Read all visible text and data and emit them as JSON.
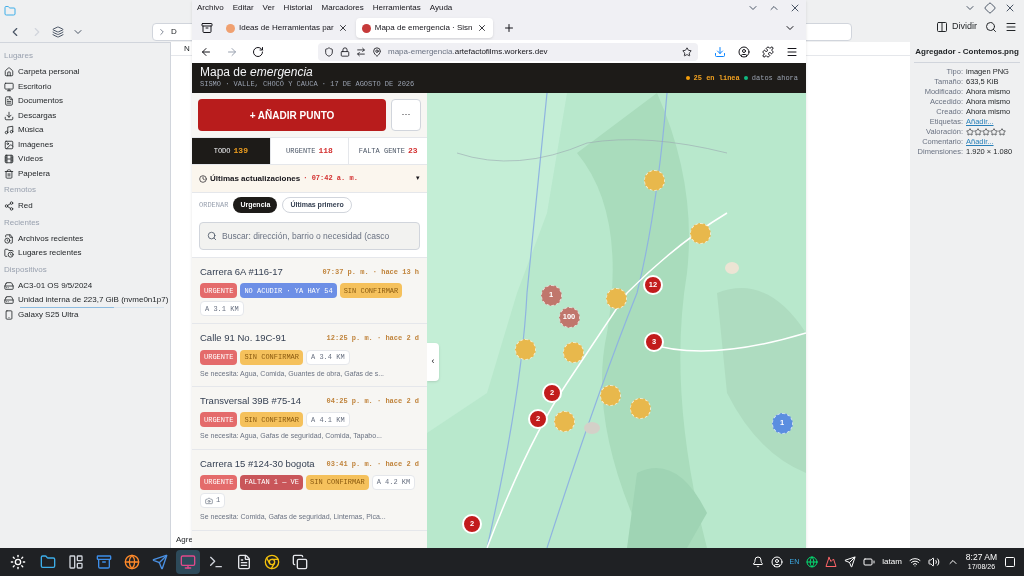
{
  "file_manager": {
    "breadcrumb": "D",
    "column_header": "N",
    "status_text": "Agre",
    "sidebar": [
      {
        "heading": "Lugares",
        "items": [
          {
            "label": "Carpeta personal",
            "kind": "home"
          },
          {
            "label": "Escritorio",
            "kind": "desktop"
          },
          {
            "label": "Documentos",
            "kind": "documents"
          },
          {
            "label": "Descargas",
            "kind": "downloads"
          },
          {
            "label": "Música",
            "kind": "music"
          },
          {
            "label": "Imágenes",
            "kind": "images"
          },
          {
            "label": "Vídeos",
            "kind": "videos"
          },
          {
            "label": "Papelera",
            "kind": "trash"
          }
        ]
      },
      {
        "heading": "Remotos",
        "items": [
          {
            "label": "Red",
            "kind": "network"
          }
        ]
      },
      {
        "heading": "Recientes",
        "items": [
          {
            "label": "Archivos recientes",
            "kind": "recent-files"
          },
          {
            "label": "Lugares recientes",
            "kind": "recent-places"
          }
        ]
      },
      {
        "heading": "Dispositivos",
        "items": [
          {
            "label": "AC3-01 OS 9/5/2024",
            "kind": "drive"
          },
          {
            "label": "Unidad interna de 223,7 GiB (nvme0n1p7)",
            "kind": "disk",
            "level": 0.65
          },
          {
            "label": "Galaxy S25 Ultra",
            "kind": "phone"
          }
        ]
      }
    ],
    "split_button": "Dividir",
    "info_panel": {
      "title": "Agregador - Contemos.png",
      "rows": [
        {
          "label": "Tipo:",
          "kind": "text",
          "value": "imagen PNG"
        },
        {
          "label": "Tamaño:",
          "kind": "text",
          "value": "633,5 KiB"
        },
        {
          "label": "Modificado:",
          "kind": "text",
          "value": "Ahora mismo"
        },
        {
          "label": "Accedido:",
          "kind": "text",
          "value": "Ahora mismo"
        },
        {
          "label": "Creado:",
          "kind": "text",
          "value": "Ahora mismo"
        },
        {
          "label": "Etiquetas:",
          "kind": "link",
          "value": "Añadir..."
        },
        {
          "label": "Valoración:",
          "kind": "stars",
          "stars": 0
        },
        {
          "label": "Comentario:",
          "kind": "link",
          "value": "Añadir..."
        },
        {
          "label": "Dimensiones:",
          "kind": "text",
          "value": "1.920 × 1.080"
        }
      ]
    }
  },
  "browser": {
    "menu": [
      "Archivo",
      "Editar",
      "Ver",
      "Historial",
      "Marcadores",
      "Herramientas",
      "Ayuda"
    ],
    "tabs": [
      {
        "title": "Ideas de Herramientas par",
        "selected": false
      },
      {
        "title": "Mapa de emergencia · Sisn",
        "selected": true
      }
    ],
    "url_host": "mapa-emergencia.",
    "url_domain": "artefactofilms.workers.dev"
  },
  "app": {
    "title": "Mapa de *emergencia*",
    "subtitle": "SISMO · VALLE, CHOCÓ Y CAUCA · 17 DE AGOSTO DE 2026",
    "status": [
      {
        "label": "25 en línea",
        "color": "#f59e0b"
      },
      {
        "label": "datos ahora",
        "color": "#10b981"
      }
    ],
    "add_button": "+ AÑADIR PUNTO",
    "more_button": "···",
    "filters": [
      {
        "label": "TODO",
        "count": "139",
        "selected": true
      },
      {
        "label": "URGENTE",
        "count": "118",
        "selected": false
      },
      {
        "label": "FALTA GENTE",
        "count": "23",
        "selected": false
      }
    ],
    "updates": {
      "label": "Últimas actualizaciones",
      "time": "· 07:42 a. m.",
      "caret": "▾"
    },
    "sort": {
      "label": "ORDENAR",
      "options": [
        {
          "label": "Urgencia",
          "selected": true
        },
        {
          "label": "Últimas primero",
          "selected": false
        }
      ]
    },
    "search": {
      "placeholder": "Buscar: dirección, barrio o necesidad (casco"
    },
    "reports": [
      {
        "title": "Carrera 6A #116-17",
        "time": "07:37 p. m. · hace 13 h",
        "tags": [
          {
            "kind": "urgent",
            "text": "URGENTE"
          },
          {
            "kind": "info",
            "text": "NO ACUDIR · YA HAY 54"
          },
          {
            "kind": "pending",
            "text": "SIN CONFIRMAR"
          },
          {
            "kind": "distance",
            "text": "A 3.1 KM"
          }
        ]
      },
      {
        "title": "Calle 91 No. 19C-91",
        "time": "12:25 p. m. · hace 2 d",
        "tags": [
          {
            "kind": "urgent",
            "text": "URGENTE"
          },
          {
            "kind": "pending",
            "text": "SIN CONFIRMAR"
          },
          {
            "kind": "distance",
            "text": "A 3.4 KM"
          }
        ],
        "needs": "Se necesita: Agua, Comida, Guantes de obra, Gafas de s..."
      },
      {
        "title": "Transversal 39B #75-14",
        "time": "04:25 p. m. · hace 2 d",
        "tags": [
          {
            "kind": "urgent",
            "text": "URGENTE"
          },
          {
            "kind": "pending",
            "text": "SIN CONFIRMAR"
          },
          {
            "kind": "distance",
            "text": "A 4.1 KM"
          }
        ],
        "needs": "Se necesita: Agua, Gafas de seguridad, Comida, Tapabo..."
      },
      {
        "title": "Carrera 15 #124-30 bogota",
        "time": "03:41 p. m. · hace 2 d",
        "tags": [
          {
            "kind": "urgent",
            "text": "URGENTE"
          },
          {
            "kind": "missing",
            "text": "FALTAN 1 — VE"
          },
          {
            "kind": "pending",
            "text": "SIN CONFIRMAR"
          },
          {
            "kind": "distance",
            "text": "A 4.2 KM"
          },
          {
            "kind": "photos",
            "text": "1"
          }
        ],
        "needs": "Se necesita: Comida, Gafas de seguridad, Linternas, Pica..."
      }
    ],
    "collapse_button": "‹",
    "markers": [
      {
        "color": "#e8b84c"
      },
      {
        "color": "#e8b84c"
      },
      {
        "color": "#e8b84c"
      },
      {
        "label": "12",
        "color": "#c21c1c"
      },
      {
        "label": "1",
        "color": "#c0766c"
      },
      {
        "label": "100",
        "color": "#c0766c"
      },
      {
        "color": "#e8b84c"
      },
      {
        "color": "#e8b84c"
      },
      {
        "label": "3",
        "color": "#c21c1c"
      },
      {
        "label": "2",
        "color": "#c21c1c"
      },
      {
        "color": "#e8b84c"
      },
      {
        "color": "#e8b84c"
      },
      {
        "label": "2",
        "color": "#c21c1c"
      },
      {
        "color": "#e8b84c"
      },
      {
        "label": "1",
        "color": "#5b8ee0"
      },
      {
        "label": "2",
        "color": "#c21c1c"
      }
    ]
  },
  "taskbar": {
    "keyboard": "EN",
    "layout": "latam",
    "time": "8:27 AM",
    "date": "17/08/26"
  }
}
